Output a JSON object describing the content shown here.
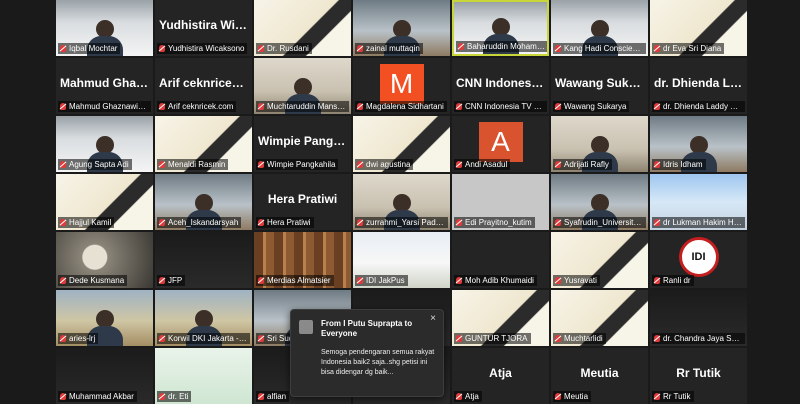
{
  "colors": {
    "background": "#1a1a1a",
    "tile": "#242424",
    "active_speaker_border": "#c8d63a",
    "muted_mic": "#e03a3a",
    "avatar_orange": "#f25022",
    "avatar_red": "#d9532f"
  },
  "participants": [
    {
      "label": "Iqbal Mochtar",
      "video": "person"
    },
    {
      "label": "Yudhistira Wicaksono",
      "big_name": "Yudhistira Wica...",
      "video": "none"
    },
    {
      "label": "Dr. Rusdani",
      "video": "poster"
    },
    {
      "label": "zainal muttaqin",
      "video": "office"
    },
    {
      "label": "Baharuddin Mohammad",
      "video": "person",
      "active": true
    },
    {
      "label": "Kang Hadi Conscience",
      "video": "person"
    },
    {
      "label": "dr Eva Sri Diana",
      "video": "poster"
    },
    {
      "label": "Mahmud Ghaznawie - ...",
      "big_name": "Mahmud Ghazn...",
      "video": "none"
    },
    {
      "label": "Arif ceknricek.com",
      "big_name": "Arif ceknricek.c...",
      "video": "none"
    },
    {
      "label": "Muchtaruddin Mansyur",
      "video": "room"
    },
    {
      "label": "Magdalena Sidhartani",
      "video": "avatar",
      "avatar_letter": "M",
      "avatar_color": "#f25022"
    },
    {
      "label": "CNN Indonesia TV 2 (3)",
      "big_name": "CNN Indonesia ...",
      "video": "none"
    },
    {
      "label": "Wawang Sukarya",
      "big_name": "Wawang Sukarya",
      "video": "none"
    },
    {
      "label": "dr. Dhienda Laddy Nas...",
      "big_name": "dr. Dhienda Lad...",
      "video": "none"
    },
    {
      "label": "Agung Sapta Adi",
      "video": "person"
    },
    {
      "label": "Menaldi Rasmin",
      "video": "poster"
    },
    {
      "label": "Wimpie Pangkahila",
      "big_name": "Wimpie Pangka...",
      "video": "none"
    },
    {
      "label": "dwi agustina",
      "video": "poster"
    },
    {
      "label": "Andi Asadul",
      "video": "avatar",
      "avatar_letter": "A",
      "avatar_color": "#d9532f"
    },
    {
      "label": "Adrijati Rafly",
      "video": "room"
    },
    {
      "label": "Idris Idham",
      "video": "office"
    },
    {
      "label": "Hajjul Kamil",
      "video": "poster"
    },
    {
      "label": "Aceh_Iskandarsyah",
      "video": "office"
    },
    {
      "label": "Hera Pratiwi",
      "big_name": "Hera Pratiwi",
      "video": "none"
    },
    {
      "label": "zurrahmi_Yarsi Padang",
      "video": "room"
    },
    {
      "label": "Edi Prayitno_kutim",
      "video": "plain"
    },
    {
      "label": "Syafrudin_Universitas ...",
      "video": "office"
    },
    {
      "label": "dr Lukman Hakim Hrp...",
      "video": "mosque"
    },
    {
      "label": "Dede Kusmana",
      "video": "lamp"
    },
    {
      "label": "JFP",
      "video": "dark"
    },
    {
      "label": "Merdias Almatsier",
      "video": "shelf"
    },
    {
      "label": "IDI JakPus",
      "video": "event"
    },
    {
      "label": "Moh Adib Khumaidi",
      "video": "none"
    },
    {
      "label": "Yusravati",
      "video": "poster"
    },
    {
      "label": "Ranli dr",
      "video": "logo",
      "logo_text": "IDI"
    },
    {
      "label": "aries-lrj",
      "video": "outdoor"
    },
    {
      "label": "Korwil DKI Jakarta - Si...",
      "video": "outdoor"
    },
    {
      "label": "Sri Sudarjo",
      "video": "office"
    },
    {
      "label": "",
      "video": "dark"
    },
    {
      "label": "GUNTUR TJORA",
      "video": "poster"
    },
    {
      "label": "Muchtarlidi",
      "video": "poster"
    },
    {
      "label": "dr. Chandra Jaya Sp.P",
      "video": "dark"
    },
    {
      "label": "Muhammad Akbar",
      "video": "dark"
    },
    {
      "label": "dr. Eti",
      "video": "green"
    },
    {
      "label": "alfian",
      "video": "dark"
    },
    {
      "label": "",
      "video": "dark"
    },
    {
      "label": "Atja",
      "big_name": "Atja",
      "video": "none"
    },
    {
      "label": "Meutia",
      "big_name": "Meutia",
      "video": "none"
    },
    {
      "label": "Rr Tutik",
      "big_name": "Rr Tutik",
      "video": "none"
    }
  ],
  "chat_popup": {
    "from_line": "From I Putu Suprapta to Everyone",
    "message": "Semoga pendengaran semua rakyat Indonesia baik2 saja..shg petisi ini bisa didengar dg baik...",
    "close_glyph": "×"
  }
}
